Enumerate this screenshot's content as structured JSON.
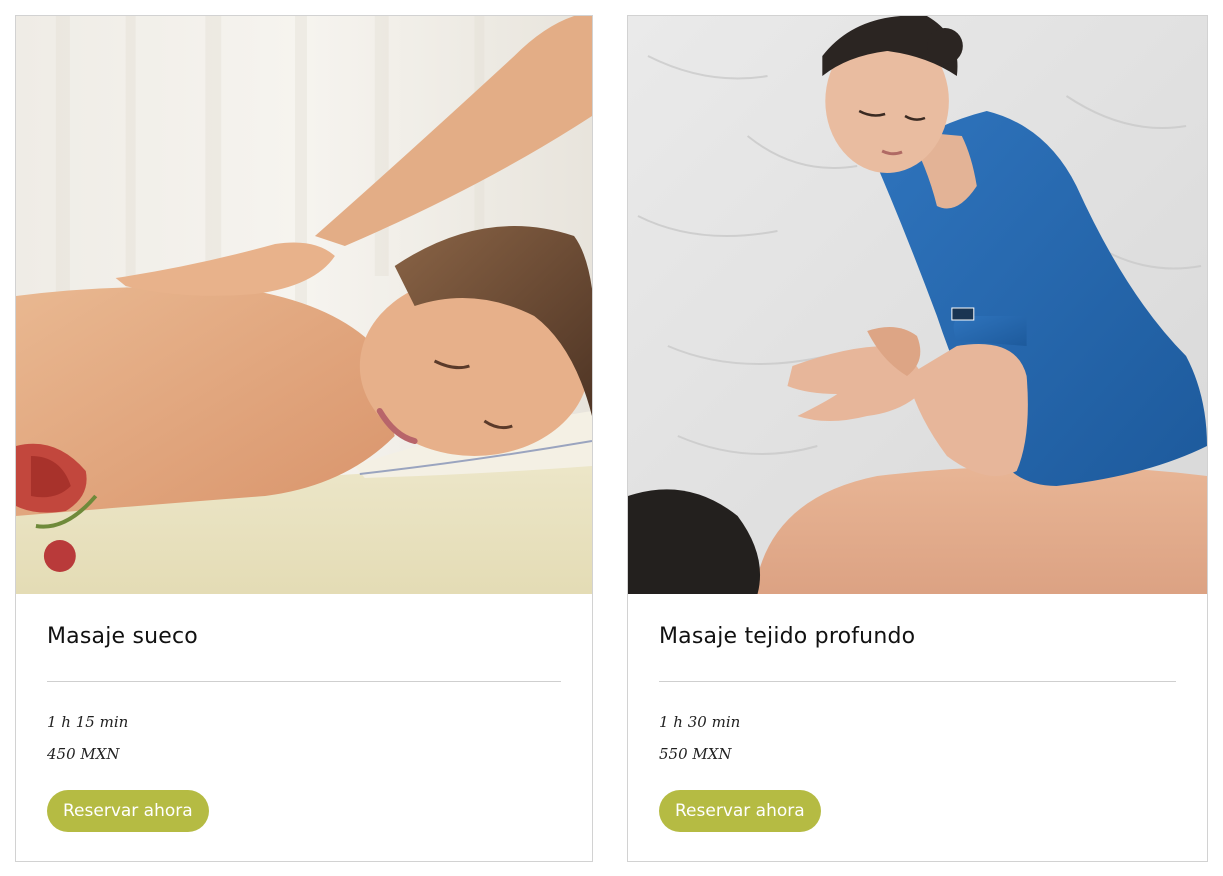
{
  "services": [
    {
      "title": "Masaje sueco",
      "duration": "1 h 15 min",
      "price": "450 MXN",
      "button_label": "Reservar ahora",
      "image_desc": "swedish-massage-photo"
    },
    {
      "title": "Masaje tejido profundo",
      "duration": "1 h 30 min",
      "price": "550 MXN",
      "button_label": "Reservar ahora",
      "image_desc": "deep-tissue-massage-photo"
    }
  ],
  "colors": {
    "button_bg": "#b5bb43",
    "button_text": "#ffffff",
    "card_border": "#d2d2d2",
    "divider": "#cfcfcf"
  }
}
